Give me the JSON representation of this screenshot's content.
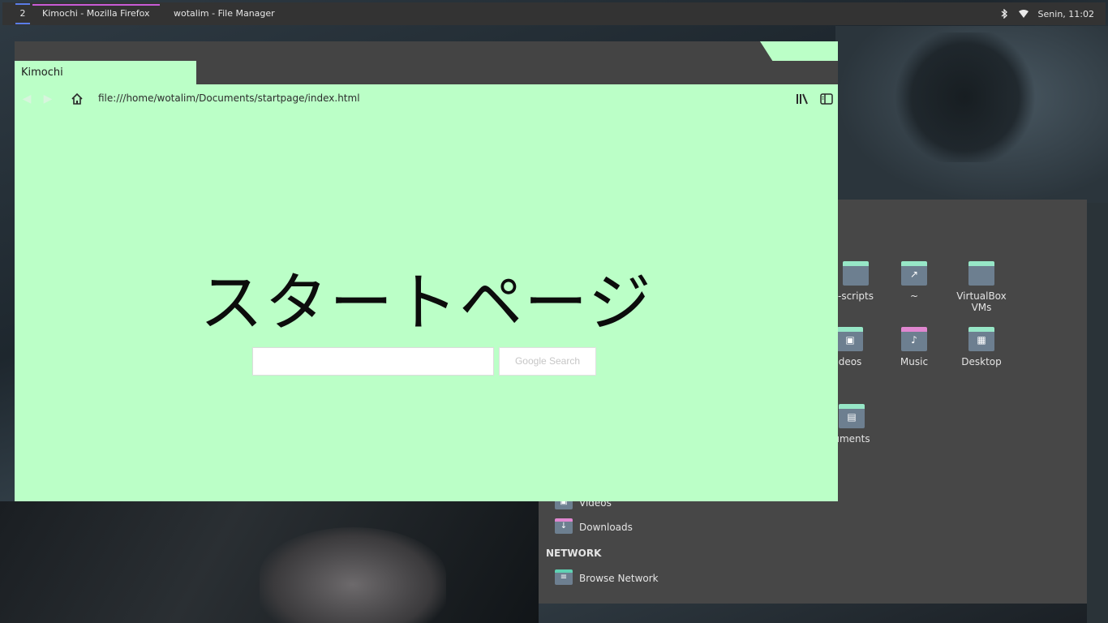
{
  "panel": {
    "workspace": "2",
    "tasks": [
      {
        "label": "Kimochi - Mozilla Firefox",
        "active": true
      },
      {
        "label": "wotalim - File Manager",
        "active": false
      }
    ],
    "clock": "Senin, 11:02",
    "tray_icons": [
      "bluetooth-icon",
      "wifi-icon"
    ]
  },
  "browser": {
    "tab_title": "Kimochi",
    "url": "file:///home/wotalim/Documents/startpage/index.html",
    "page_heading": "スタートページ",
    "search_input_value": "",
    "search_button_label": "Google Search",
    "colors": {
      "page_bg": "#bbffc7",
      "titlebar": "#444444"
    }
  },
  "file_manager": {
    "grid_items": [
      {
        "label": "-scripts",
        "icon": "folder-icon"
      },
      {
        "label": "~",
        "icon": "folder-icon"
      },
      {
        "label": "VirtualBox VMs",
        "icon": "folder-icon"
      },
      {
        "label": "deos",
        "icon": "video-folder-icon"
      },
      {
        "label": "Music",
        "icon": "music-folder-icon"
      },
      {
        "label": "Desktop",
        "icon": "desktop-folder-icon"
      },
      {
        "label": "uments",
        "icon": "documents-folder-icon"
      }
    ],
    "sidebar": {
      "places": [
        {
          "label": "Videos",
          "icon": "video-folder-icon"
        },
        {
          "label": "Downloads",
          "icon": "download-folder-icon"
        }
      ],
      "network_heading": "NETWORK",
      "network": [
        {
          "label": "Browse Network",
          "icon": "network-icon"
        }
      ]
    }
  }
}
